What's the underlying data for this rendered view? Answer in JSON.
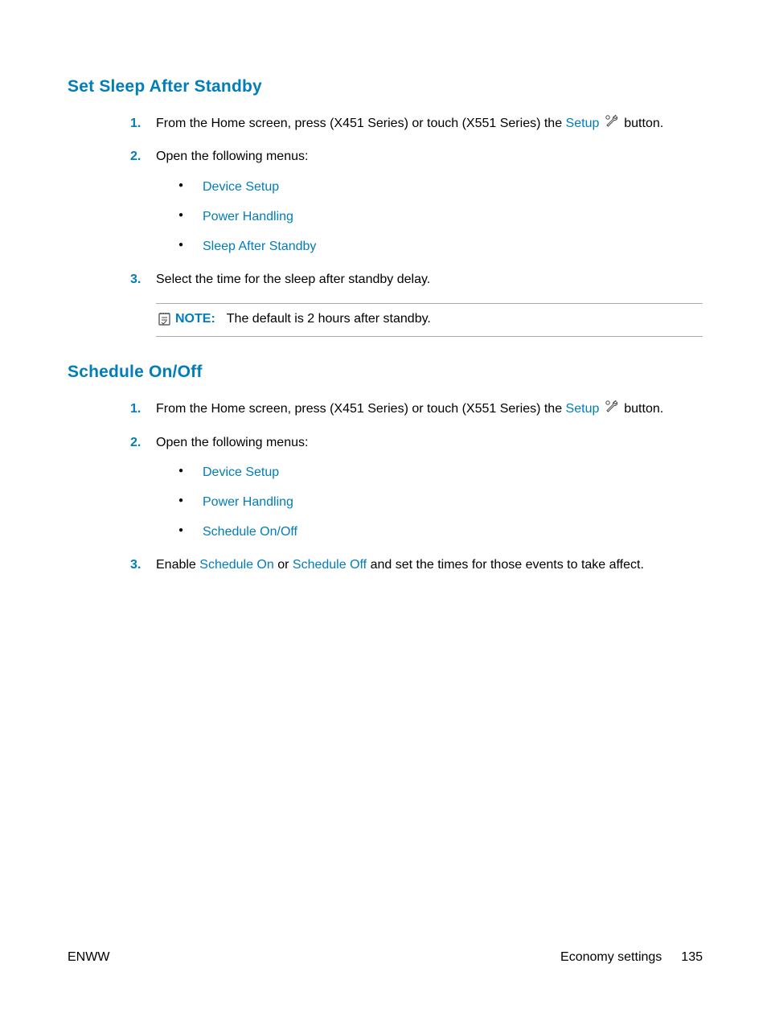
{
  "section1": {
    "heading": "Set Sleep After Standby",
    "steps": {
      "s1": {
        "num": "1.",
        "pre": "From the Home screen, press (X451 Series) or touch (X551 Series) the ",
        "setup": "Setup",
        "post": " button."
      },
      "s2": {
        "num": "2.",
        "text": "Open the following menus:",
        "bullets": {
          "b1": "Device Setup",
          "b2": "Power Handling",
          "b3": "Sleep After Standby"
        }
      },
      "s3": {
        "num": "3.",
        "text": "Select the time for the sleep after standby delay."
      }
    },
    "note": {
      "label": "NOTE:",
      "text": "The default is 2 hours after standby."
    }
  },
  "section2": {
    "heading": "Schedule On/Off",
    "steps": {
      "s1": {
        "num": "1.",
        "pre": "From the Home screen, press (X451 Series) or touch (X551 Series) the ",
        "setup": "Setup",
        "post": " button."
      },
      "s2": {
        "num": "2.",
        "text": "Open the following menus:",
        "bullets": {
          "b1": "Device Setup",
          "b2": "Power Handling",
          "b3": "Schedule On/Off"
        }
      },
      "s3": {
        "num": "3.",
        "pre": "Enable ",
        "link1": "Schedule On",
        "mid": " or ",
        "link2": "Schedule Off",
        "post": " and set the times for those events to take affect."
      }
    }
  },
  "footer": {
    "left": "ENWW",
    "rightLabel": "Economy settings",
    "pageNum": "135"
  }
}
